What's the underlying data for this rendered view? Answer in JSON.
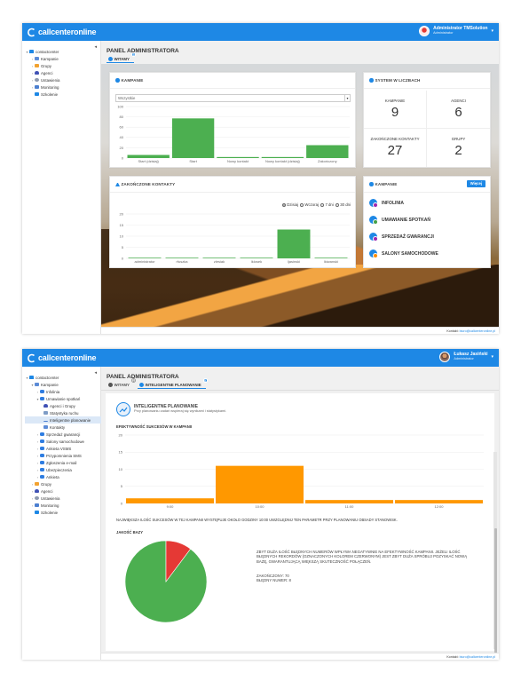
{
  "brand": {
    "name": "callcenteronline",
    "accent": "#1e88e5"
  },
  "screen1": {
    "user": {
      "name": "Administrator TMSolution",
      "role": "Administrator"
    },
    "sidebar": {
      "root": "contactcenter",
      "items": [
        "Kampanie",
        "Grupy",
        "Agenci",
        "Ustawienia",
        "Monitoring",
        "Szkolenie"
      ]
    },
    "page_title": "PANEL ADMINISTRATORA",
    "tabs": [
      {
        "label": "WITAMY",
        "badge": "0"
      }
    ],
    "campaign_chart": {
      "header": "KAMPANIE",
      "select_value": "Wszystkie",
      "chart_data": {
        "type": "bar",
        "categories": [
          "Start (dzisiaj)",
          "Start",
          "Nowy kontakt",
          "Nowy kontakt (dzisiaj)",
          "Zakończony"
        ],
        "values": [
          6,
          77,
          2,
          2,
          25
        ],
        "ylim": [
          0,
          100
        ],
        "yticks": [
          0,
          20,
          40,
          60,
          80,
          100
        ],
        "color": "#4caf50"
      }
    },
    "stats": {
      "header": "SYSTEM W LICZBACH",
      "cells": [
        {
          "label": "KAMPANIE",
          "value": "9"
        },
        {
          "label": "AGENCI",
          "value": "6"
        },
        {
          "label": "ZAKOŃCZONE KONTAKTY",
          "value": "27"
        },
        {
          "label": "GRUPY",
          "value": "2"
        }
      ]
    },
    "completed_chart": {
      "header": "ZAKOŃCZONE KONTAKTY",
      "radios": [
        {
          "label": "Dzisiaj",
          "checked": true
        },
        {
          "label": "Wczoraj",
          "checked": false
        },
        {
          "label": "7 dni",
          "checked": false
        },
        {
          "label": "30 dni",
          "checked": false
        }
      ],
      "chart_data": {
        "type": "bar",
        "categories": [
          "administrator",
          "rfuszka",
          "zlesiak",
          "lklosek",
          "ljasinski",
          "lkiwanski"
        ],
        "values": [
          0.3,
          0.3,
          0.3,
          0.3,
          13,
          0.3
        ],
        "ylim": [
          0,
          20
        ],
        "yticks": [
          0,
          5,
          10,
          15,
          20
        ],
        "color": "#4caf50"
      }
    },
    "campaign_list": {
      "header": "KAMPANIE",
      "more_label": "Więcej",
      "items": [
        "INFOLINIA",
        "UMAWIANIE SPOTKAŃ",
        "SPRZEDAŻ GWARANCJI",
        "SALONY SAMOCHODOWE"
      ]
    },
    "footer": {
      "label": "Kontakt:",
      "email": "biuro@callcenteronline.pl"
    }
  },
  "screen2": {
    "user": {
      "name": "Łukasz Jasiński",
      "role": "Administrator"
    },
    "sidebar": {
      "root": "contactcenter",
      "items": [
        {
          "label": "Infolinia",
          "level": 1
        },
        {
          "label": "Umawianie spotkań",
          "level": 1
        },
        {
          "label": "Agenci i Grupy",
          "level": 2
        },
        {
          "label": "Statystyka ruchu",
          "level": 2
        },
        {
          "label": "Inteligentne planowanie",
          "level": 2,
          "active": true
        },
        {
          "label": "Kontakty",
          "level": 2
        },
        {
          "label": "Sprzedaż gwarancji",
          "level": 1
        },
        {
          "label": "Salony samochodowe",
          "level": 1
        },
        {
          "label": "Ankieta VSMS",
          "level": 1
        },
        {
          "label": "Przypomnienia SMS",
          "level": 1
        },
        {
          "label": "Zgłoszenia e-mail",
          "level": 1
        },
        {
          "label": "Ubezpieczenia",
          "level": 1
        },
        {
          "label": "Ankieta",
          "level": 1
        },
        {
          "label": "Grupy",
          "level": 0
        },
        {
          "label": "Agenci",
          "level": 0
        },
        {
          "label": "Ustawienia",
          "level": 0
        },
        {
          "label": "Monitoring",
          "level": 0
        },
        {
          "label": "Szkolenie",
          "level": 0
        }
      ]
    },
    "page_title": "PANEL ADMINISTRATORA",
    "tabs": [
      {
        "label": "WITAMY",
        "badge": "0"
      },
      {
        "label": "INTELIGENTNE PLANOWANIE",
        "badge": "0"
      }
    ],
    "planning": {
      "title": "INTELIGENTNE PLANOWANIE",
      "subtitle": "Przy planowaniu zadań wspieraj się wynikami i statystykami.",
      "section_title": "EFEKTYWNOŚĆ SUKCESÓW W KAMPANII",
      "chart_data": {
        "type": "bar",
        "categories": [
          "9:00",
          "10:00",
          "11:00",
          "12:00"
        ],
        "values": [
          1.5,
          11,
          1,
          1
        ],
        "ylim": [
          0,
          20
        ],
        "yticks": [
          0,
          5,
          10,
          15,
          20
        ],
        "color": "#ff9800"
      },
      "insight": "NAJWIĘKSZA ILOŚĆ SUKCESÓW W TEJ KAMPANII WYSTĘPUJE OKOŁO GODZINY 10:00 UWZGLĘDNIJ TEN PARAMETR PRZY PLANOWANIU OBSADY STANOWISK.",
      "quality_title": "JAKOŚĆ BAZY",
      "pie_data": {
        "type": "pie",
        "labels": [
          "ZAKOŃCZONY",
          "BŁĘDNY NUMER"
        ],
        "values": [
          70,
          8
        ],
        "colors": [
          "#4caf50",
          "#e53935"
        ]
      },
      "quality_note": "ZBYT DUŻA ILOŚĆ BŁĘDNYCH NUMERÓW WPŁYWA NEGATYWNIE NA EFEKTYWNOŚĆ KAMPANII. JEŻELI ILOŚĆ BŁĘDNYCH REKORDÓW (OZNACZONYCH KOLOREM CZERWONYM) JEST ZBYT DUŻA SPRÓBUJ POZYSKAĆ NOWĄ BAZĘ, GWARANTUJĄCĄ WIĘKSZĄ SKUTECZNOŚĆ POŁĄCZEŃ.",
      "legend_completed": "ZAKOŃCZONY: 70",
      "legend_wrong": "BŁĘDNY NUMER: 8"
    },
    "footer": {
      "label": "Kontakt:",
      "email": "biuro@callcenteronline.pl"
    }
  }
}
